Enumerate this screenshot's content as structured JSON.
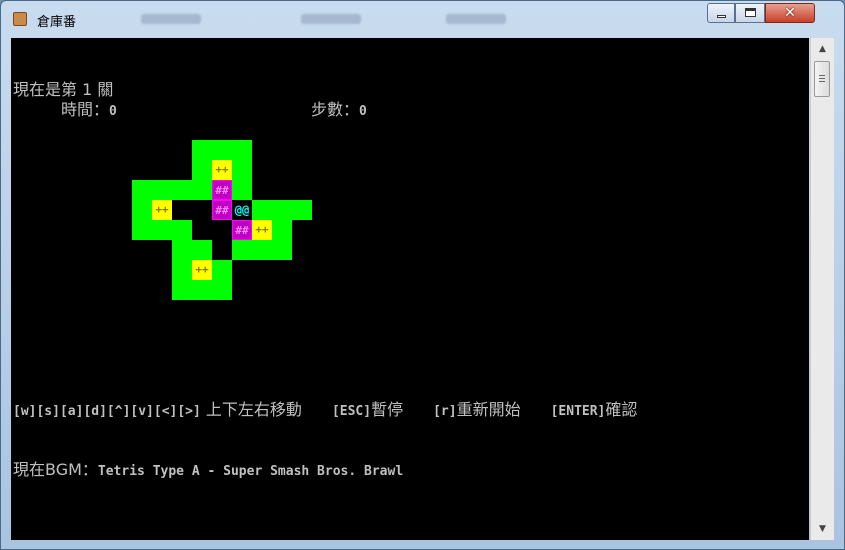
{
  "window": {
    "title": "倉庫番"
  },
  "console": {
    "level_text": "現在是第 1 關",
    "time_label": "時間：",
    "time_value": "0",
    "steps_label": "步數：",
    "steps_value": "0",
    "controls": {
      "move_keys": "[w][s][a][d][^][v][<][>]",
      "move_label": " 上下左右移動",
      "esc_key": "[ESC]",
      "esc_label": "暫停",
      "r_key": "[r]",
      "r_label": "重新開始",
      "enter_key": "[ENTER]",
      "enter_label": "確認"
    },
    "bgm_label": "現在BGM：",
    "bgm_track": "Tetris Type A - Super Smash Bros. Brawl"
  },
  "board": {
    "glyphs": {
      "target": "++",
      "box": "##",
      "player": "@@"
    },
    "colors": {
      "wall": "#00ff00",
      "target": "#ffff00",
      "box": "#c000c0",
      "player": "#00ffff",
      "background": "#000000"
    },
    "rows": [
      "...WWW.",
      "...WTW.",
      "WWWWBW.",
      "WT..B@WWW",
      "WWW..BTW",
      "..WW.WWW",
      "..WTW..",
      "..WWW.."
    ]
  }
}
